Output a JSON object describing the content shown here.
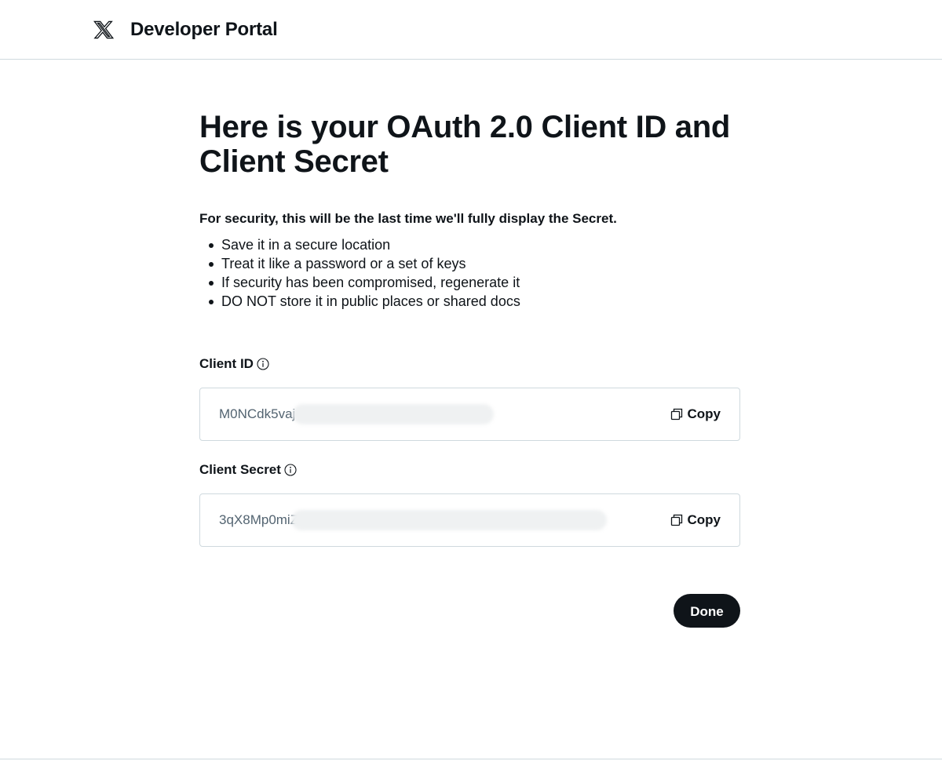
{
  "header": {
    "logo_icon": "x-logo-icon",
    "brand": "Developer Portal"
  },
  "main": {
    "title": "Here is your OAuth 2.0 Client ID and Client Secret",
    "security_note": "For security, this will be the last time we'll fully display the Secret.",
    "tips": [
      "Save it in a secure location",
      "Treat it like a password or a set of keys",
      "If security has been compromised, regenerate it",
      "DO NOT store it in public places or shared docs"
    ],
    "client_id": {
      "label": "Client ID",
      "value": "M0NCdk5vaj",
      "copy_label": "Copy"
    },
    "client_secret": {
      "label": "Client Secret",
      "value": "3qX8Mp0miZ",
      "copy_label": "Copy"
    },
    "done_label": "Done"
  },
  "colors": {
    "text": "#0f1419",
    "muted": "#536471",
    "border": "#cfd9de",
    "button_bg": "#0f1419"
  }
}
